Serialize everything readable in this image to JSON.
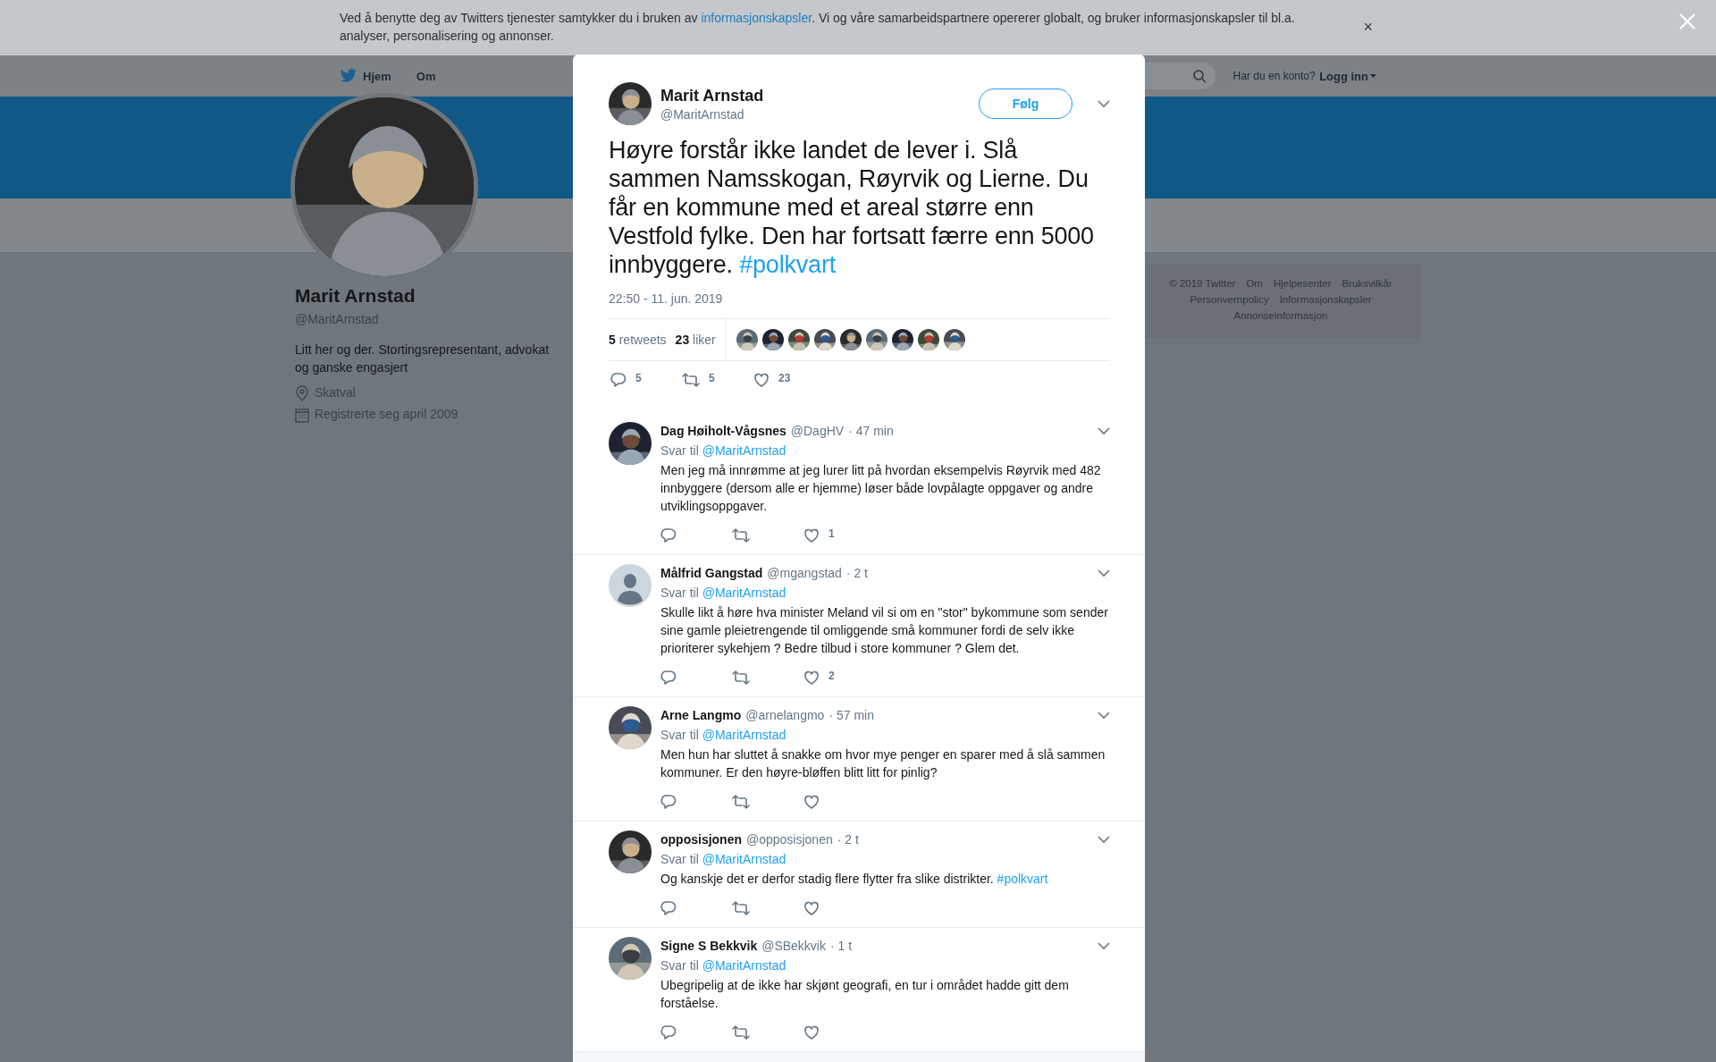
{
  "cookie_banner": {
    "text_before": "Ved å benytte deg av Twitters tjenester samtykker du i bruken av ",
    "link": "informasjonskapsler",
    "text_after": ". Vi og våre samarbeidspartnere opererer globalt, og bruker informasjonskapsler til bl.a. analyser, personalisering og annonser.",
    "close": "×"
  },
  "nav": {
    "items": [
      {
        "kind": "home",
        "label": "Hjem"
      },
      {
        "kind": "plain",
        "label": "Om"
      }
    ],
    "login_prompt": "Har du en konto?",
    "login_link": "Logg inn"
  },
  "profile": {
    "name": "Marit Arnstad",
    "handle": "@MaritArnstad",
    "bio": "Litt her og der. Stortingsrepresentant, advokat og ganske engasjert",
    "location": "Skatval",
    "joined": "Registrerte seg april 2009"
  },
  "footer_links": [
    "© 2019 Twitter",
    "Om",
    "Hjelpesenter",
    "Bruksvilkår",
    "Personvernpolicy",
    "Informasjonskapsler",
    "Annonseinformasjon"
  ],
  "modal": {
    "author": {
      "name": "Marit Arnstad",
      "handle": "@MaritArnstad"
    },
    "follow_button": "Følg",
    "text": "Høyre forstår ikke landet de lever i. Slå sammen Namsskogan, Røyrvik og Lierne. Du får en kommune med et areal større enn Vestfold fylke. Den har fortsatt færre enn 5000 innbyggere. ",
    "hashtag": "#polkvart",
    "timestamp": "22:50 - 11. jun. 2019",
    "stats": [
      {
        "count": "5",
        "label": "retweets"
      },
      {
        "count": "23",
        "label": "liker"
      }
    ],
    "actions": [
      {
        "kind": "reply",
        "count": "5"
      },
      {
        "kind": "retweet",
        "count": "5"
      },
      {
        "kind": "like",
        "count": "23"
      }
    ]
  },
  "replies": [
    {
      "name": "Dag Høiholt-Vågsnes",
      "handle": "@DagHV",
      "time": "· 47 min",
      "reply_prefix": "Svar til",
      "reply_to": "@MaritArnstad",
      "text": "Men jeg må innrømme at jeg lurer litt på hvordan eksempelvis Røyrvik med 482 innbyggere (dersom alle er hjemme) løser både lovpålagte oppgaver og andre utviklingsoppgaver.",
      "likes": "1"
    },
    {
      "avatar": {
        "kind": "default"
      },
      "name": "Målfrid Gangstad",
      "handle": "@mgangstad",
      "time": "· 2 t",
      "reply_prefix": "Svar til",
      "reply_to": "@MaritArnstad",
      "text": "Skulle likt å høre hva minister Meland vil si om en \"stor\" bykommune som sender sine gamle pleietrengende til omliggende små kommuner fordi de selv ikke prioriterer sykehjem ? Bedre tilbud i store kommuner ? Glem det.",
      "likes": "2"
    },
    {
      "name": "Arne Langmo",
      "handle": "@arnelangmo",
      "time": "· 57 min",
      "reply_prefix": "Svar til",
      "reply_to": "@MaritArnstad",
      "text": "Men hun har sluttet å snakke om hvor mye penger en sparer med å slå sammen kommuner. Er den høyre-bløffen blitt litt for pinlig?"
    },
    {
      "name": "opposisjonen",
      "handle": "@opposisjonen",
      "time": "· 2 t",
      "reply_prefix": "Svar til",
      "reply_to": "@MaritArnstad",
      "text": "Og kanskje det er derfor stadig flere flytter fra slike distrikter. ",
      "hashtag": "#polkvart"
    },
    {
      "name": "Signe S Bekkvik",
      "handle": "@SBekkvik",
      "time": "· 1 t",
      "reply_prefix": "Svar til",
      "reply_to": "@MaritArnstad",
      "text": "Ubegripelig at de ikke har skjønt geografi, en tur i området hadde gitt dem forståelse."
    }
  ]
}
